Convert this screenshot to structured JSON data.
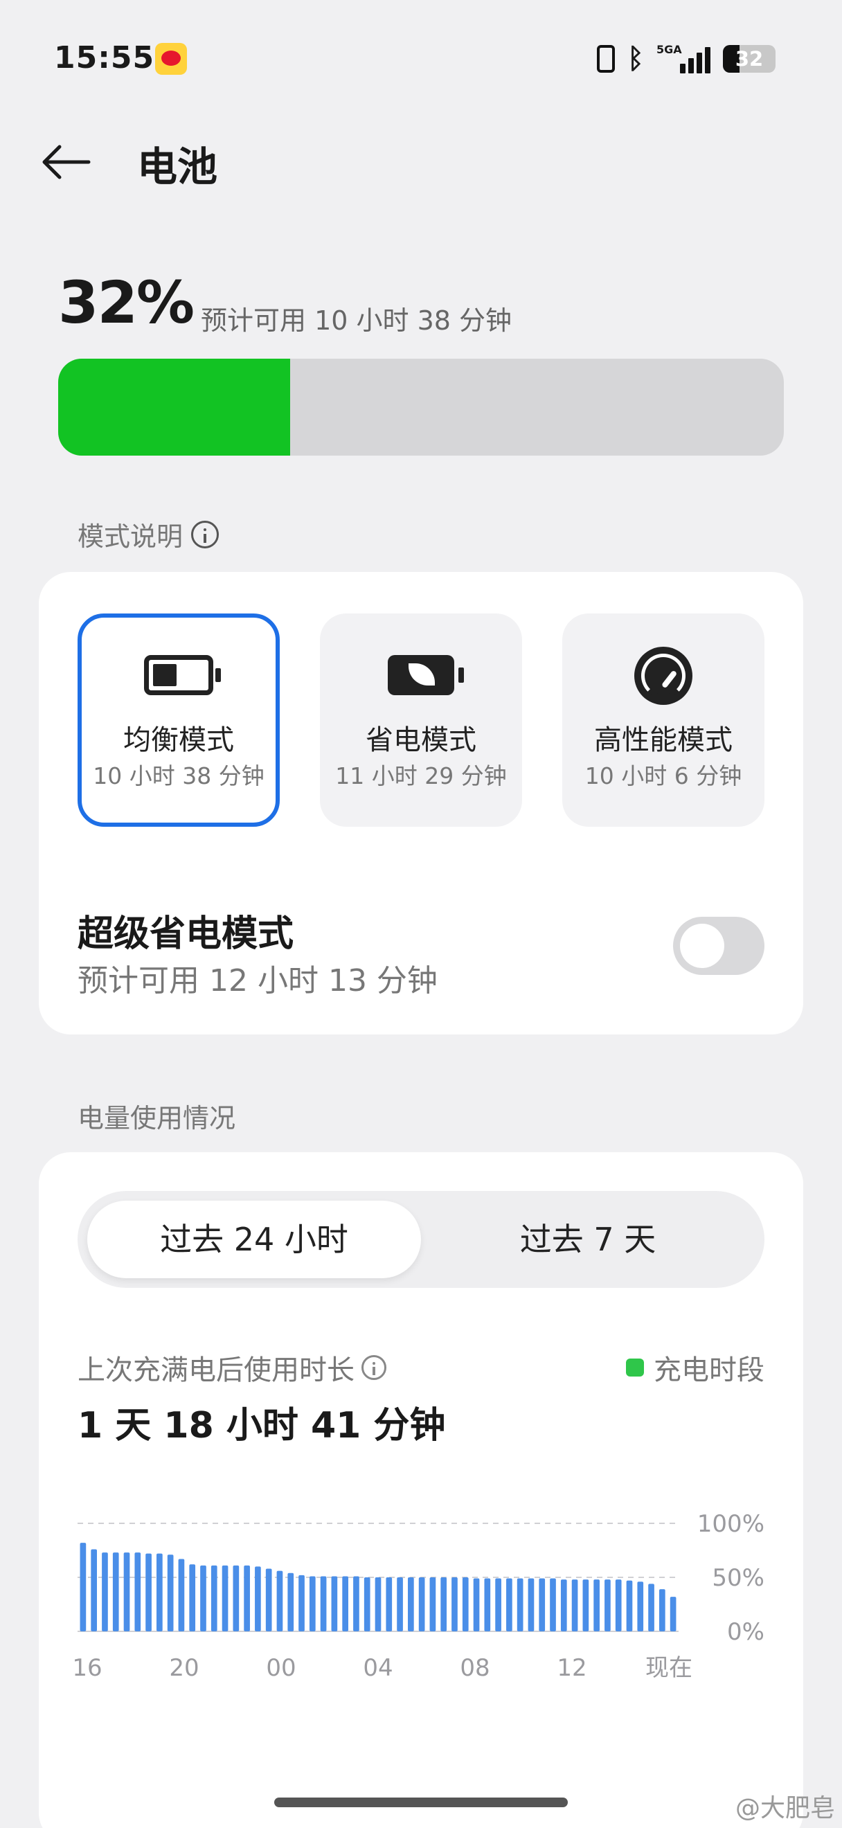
{
  "status_bar": {
    "time": "15:55",
    "network": "5GA",
    "battery_level": "32",
    "battery_fraction": 0.32,
    "icons": [
      "weibo-app-icon",
      "vibrate-icon",
      "bluetooth-icon",
      "signal-icon",
      "battery-icon"
    ]
  },
  "header": {
    "title": "电池",
    "back_icon": "back-arrow-icon"
  },
  "battery": {
    "percent": "32%",
    "estimate": "预计可用 10 小时 38 分钟",
    "level": 0.32,
    "fill_color": "#12c323",
    "track_color": "#d6d6d8"
  },
  "modes": {
    "section_label": "模式说明",
    "items": [
      {
        "name": "均衡模式",
        "time": "10 小时 38 分钟",
        "icon": "battery-half-icon",
        "selected": true
      },
      {
        "name": "省电模式",
        "time": "11 小时 29 分钟",
        "icon": "leaf-battery-icon",
        "selected": false
      },
      {
        "name": "高性能模式",
        "time": "10 小时 6 分钟",
        "icon": "speedometer-icon",
        "selected": false
      }
    ],
    "selected_color": "#1e6fe6",
    "super_saver": {
      "title": "超级省电模式",
      "subtitle": "预计可用 12 小时 13 分钟",
      "enabled": false
    }
  },
  "usage": {
    "section_label": "电量使用情况",
    "tabs": [
      {
        "label": "过去 24 小时",
        "active": true
      },
      {
        "label": "过去 7 天",
        "active": false
      }
    ],
    "since_full_label": "上次充满电后使用时长",
    "since_full_value": "1 天 18 小时 41 分钟",
    "charge_legend": "充电时段",
    "charge_color": "#2fc64a",
    "bar_color": "#4a8ee8"
  },
  "chart_data": {
    "type": "bar",
    "title": "",
    "xlabel": "",
    "ylabel": "",
    "y_tick_labels": [
      "100%",
      "50%",
      "0%"
    ],
    "ylim": [
      0,
      100
    ],
    "x_tick_labels": [
      "16",
      "20",
      "00",
      "04",
      "08",
      "12",
      "现在"
    ],
    "grid": true,
    "series": [
      {
        "values": [
          82,
          76,
          73,
          73,
          73,
          73,
          72,
          72,
          71,
          67,
          62,
          61,
          61,
          61,
          61,
          61,
          60,
          58,
          56,
          54,
          52,
          51,
          51,
          51,
          51,
          51,
          50,
          50,
          50,
          50,
          50,
          50,
          50,
          50,
          50,
          50,
          49,
          49,
          49,
          49,
          49,
          49,
          49,
          49,
          48,
          48,
          48,
          48,
          48,
          48,
          47,
          46,
          44,
          39,
          32
        ]
      }
    ]
  },
  "watermark": "@大肥皂"
}
